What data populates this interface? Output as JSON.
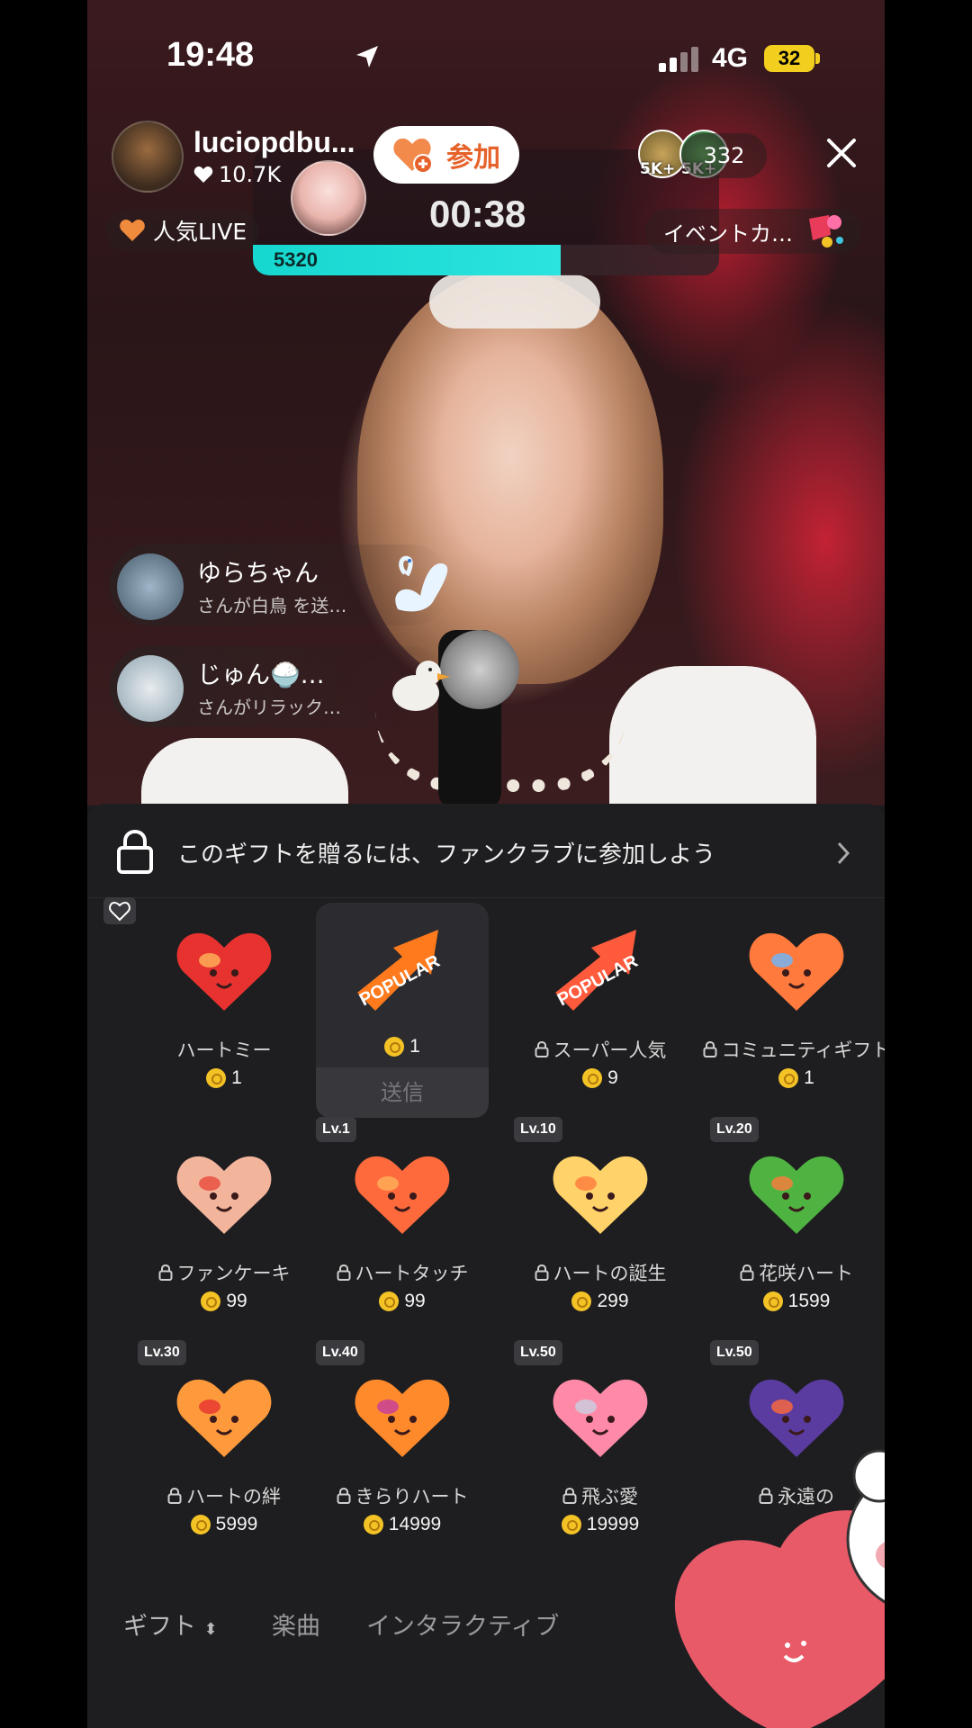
{
  "status_bar": {
    "time": "19:48",
    "network": "4G",
    "battery": "32"
  },
  "host": {
    "name": "luciopdbu...",
    "likes": "10.7K"
  },
  "join_button": {
    "label": "参加"
  },
  "viewers": {
    "badge_1": "5K+",
    "badge_2": "5K+",
    "count": "332"
  },
  "popular_live": {
    "label": "人気LIVE"
  },
  "battle": {
    "timer": "00:38",
    "score": "5320",
    "progress": 0.66
  },
  "event_button": {
    "label": "イベントカ…"
  },
  "notifications": [
    {
      "name": "ゆらちゃん",
      "message": "さんが白鳥 を送…"
    },
    {
      "name": "じゅん🍚…",
      "message": "さんがリラック…"
    }
  ],
  "fanclub": {
    "text": "このギフトを贈るには、ファンクラブに参加しよう"
  },
  "gifts": [
    {
      "name": "ハートミー",
      "price": "1",
      "locked": false,
      "level": "",
      "icon": "heart-me-icon"
    },
    {
      "name": "",
      "price": "1",
      "locked": false,
      "level": "",
      "icon": "popular-icon",
      "selected": true,
      "send_label": "送信"
    },
    {
      "name": "スーパー人気",
      "price": "9",
      "locked": true,
      "level": "",
      "icon": "super-popular-icon"
    },
    {
      "name": "コミュニティギフト",
      "price": "1",
      "locked": true,
      "level": "",
      "icon": "community-gift-icon"
    },
    {
      "name": "ファンケーキ",
      "price": "99",
      "locked": true,
      "level": "",
      "icon": "fan-cake-icon"
    },
    {
      "name": "ハートタッチ",
      "price": "99",
      "locked": true,
      "level": "Lv.1",
      "icon": "heart-touch-icon"
    },
    {
      "name": "ハートの誕生",
      "price": "299",
      "locked": true,
      "level": "Lv.10",
      "icon": "heart-birth-icon"
    },
    {
      "name": "花咲ハート",
      "price": "1599",
      "locked": true,
      "level": "Lv.20",
      "icon": "blooming-heart-icon"
    },
    {
      "name": "ハートの絆",
      "price": "5999",
      "locked": true,
      "level": "Lv.30",
      "icon": "heart-bond-icon"
    },
    {
      "name": "きらりハート",
      "price": "14999",
      "locked": true,
      "level": "Lv.40",
      "icon": "sparkle-heart-icon"
    },
    {
      "name": "飛ぶ愛",
      "price": "19999",
      "locked": true,
      "level": "Lv.50",
      "icon": "flying-love-icon"
    },
    {
      "name": "永遠の",
      "price": "",
      "locked": true,
      "level": "Lv.50",
      "icon": "eternal-love-icon"
    }
  ],
  "tabs": {
    "gift": "ギフト",
    "music": "楽曲",
    "interactive": "インタラクティブ"
  },
  "colors": {
    "accent": "#e6622b",
    "score_bar": "#1ad9d1",
    "coin": "#f3c326",
    "panel_bg": "#1e1e20"
  }
}
